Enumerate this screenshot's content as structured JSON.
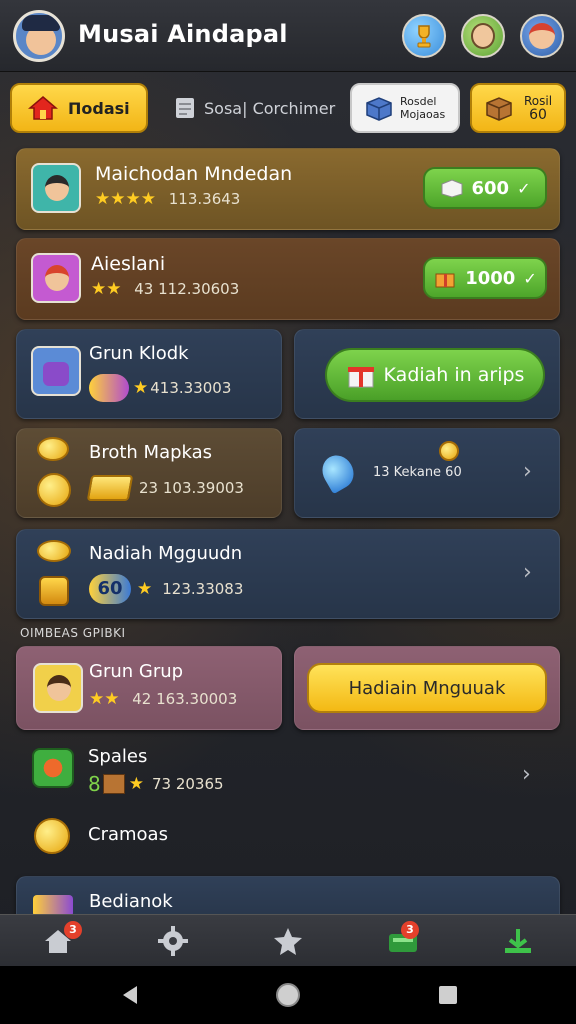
{
  "header": {
    "title": "Musai Aindapal"
  },
  "tabs": {
    "home_label": "Πodasi",
    "social_label": "Sosa| Corchimer",
    "mission_label_1": "Rosdel",
    "mission_label_2": "Mojaoas",
    "shop_label_1": "Rosil",
    "shop_label_2": "60"
  },
  "cards": {
    "card1": {
      "title": "Maichodan Mndedan",
      "meta": "113.3643",
      "reward": "600"
    },
    "card2": {
      "title": "Aieslani",
      "meta": "43  112.30603",
      "reward": "1000"
    },
    "card3": {
      "title": "Grun Klodk",
      "meta": "413.33003",
      "action": "Kadiah in arips"
    },
    "card4": {
      "title": "Broth Mapkas",
      "meta": "23   103.39003",
      "side_text": "13 Kekane 60"
    },
    "card5": {
      "title": "Nadiah Mgguudn",
      "meta": "123.33083",
      "badge": "60"
    },
    "section_label": "OIMBEAS GPIBKI",
    "card6": {
      "title": "Grun Grup",
      "meta": "42   163.30003",
      "action": "Hadiain Mnguuak"
    },
    "card7": {
      "title": "Spales",
      "meta": "73 20365",
      "prefix": "8"
    },
    "card8": {
      "title": "Cramoas"
    },
    "card9": {
      "title": "Bedianok"
    }
  },
  "bottom_nav": {
    "home_badge": "3",
    "shop_badge": "3"
  },
  "colors": {
    "accent_yellow": "#f2b516",
    "accent_green": "#4da52a",
    "badge_red": "#e4402b"
  }
}
